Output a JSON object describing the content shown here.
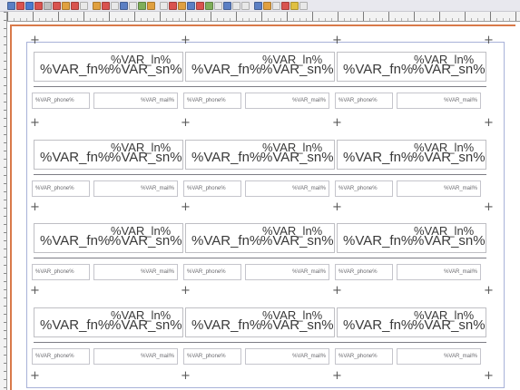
{
  "toolbar": {
    "buttons": [
      {
        "icon": "new-icon",
        "color": "#5b7fc4"
      },
      {
        "icon": "open-icon",
        "color": "#d9534f"
      },
      {
        "icon": "save-icon",
        "color": "#4a7bd0"
      },
      {
        "icon": "print-icon",
        "color": "#d9534f"
      },
      {
        "icon": "cut-icon",
        "color": "#c0c0c0"
      },
      {
        "icon": "copy-icon",
        "color": "#d9534f"
      },
      {
        "icon": "paste-icon",
        "color": "#e0a040"
      },
      {
        "icon": "undo-icon",
        "color": "#d9534f"
      },
      {
        "icon": "redo-icon",
        "color": "#e8e8e8"
      },
      {
        "icon": "zoom-icon",
        "color": "#e0a040"
      },
      {
        "icon": "frame-icon",
        "color": "#d9534f"
      },
      {
        "icon": "grid-icon",
        "color": "#e8e8e8"
      },
      {
        "icon": "table-icon",
        "color": "#5b7fc4"
      },
      {
        "icon": "image-icon",
        "color": "#e8e8e8"
      },
      {
        "icon": "shape-icon",
        "color": "#7fae5a"
      },
      {
        "icon": "line-icon",
        "color": "#e0a040"
      },
      {
        "icon": "text-icon",
        "color": "#e8e8e8"
      },
      {
        "icon": "pen-icon",
        "color": "#d9534f"
      },
      {
        "icon": "pencil-icon",
        "color": "#e0a040"
      },
      {
        "icon": "brush-icon",
        "color": "#5b7fc4"
      },
      {
        "icon": "eyedropper-icon",
        "color": "#d9534f"
      },
      {
        "icon": "measure-icon",
        "color": "#7fae5a"
      },
      {
        "icon": "align-icon",
        "color": "#e8e8e8"
      },
      {
        "icon": "link-icon",
        "color": "#5b7fc4"
      },
      {
        "icon": "unlink-icon",
        "color": "#e8e8e8"
      },
      {
        "icon": "font-icon",
        "color": "#e8e8e8"
      },
      {
        "icon": "script-icon",
        "color": "#5b7fc4"
      },
      {
        "icon": "chart-icon",
        "color": "#e0a040"
      },
      {
        "icon": "barcode-icon",
        "color": "#e8e8e8"
      },
      {
        "icon": "pdf-icon",
        "color": "#d9534f"
      },
      {
        "icon": "color-icon",
        "color": "#e0c040"
      },
      {
        "icon": "lightning-icon",
        "color": "#e8e8e8"
      }
    ]
  },
  "accent": {
    "page_edge": "#d97a4a",
    "margin_line": "#a8b2d8"
  },
  "labels": {
    "first_name": "%VAR_fn%",
    "last_name_top": "%VAR_ln%",
    "last_name_bottom": "%VAR_sn%",
    "phone": "%VAR_phone%",
    "mail": "%VAR_mail%"
  },
  "cards": [
    {
      "row": 1,
      "col": 1,
      "fn": "%VAR_fn%",
      "ln": "%VAR_ln%",
      "sn": "%VAR_sn%",
      "phone": "%VAR_phone%",
      "mail": "%VAR_mail%"
    },
    {
      "row": 1,
      "col": 2,
      "fn": "%VAR_fn%",
      "ln": "%VAR_ln%",
      "sn": "%VAR_sn%",
      "phone": "%VAR_phone%",
      "mail": "%VAR_mail%"
    },
    {
      "row": 1,
      "col": 3,
      "fn": "%VAR_fn%",
      "ln": "%VAR_ln%",
      "sn": "%VAR_sn%",
      "phone": "%VAR_phone%",
      "mail": "%VAR_mail%"
    },
    {
      "row": 2,
      "col": 1,
      "fn": "%VAR_fn%",
      "ln": "%VAR_ln%",
      "sn": "%VAR_sn%",
      "phone": "%VAR_phone%",
      "mail": "%VAR_mail%"
    },
    {
      "row": 2,
      "col": 2,
      "fn": "%VAR_fn%",
      "ln": "%VAR_ln%",
      "sn": "%VAR_sn%",
      "phone": "%VAR_phone%",
      "mail": "%VAR_mail%"
    },
    {
      "row": 2,
      "col": 3,
      "fn": "%VAR_fn%",
      "ln": "%VAR_ln%",
      "sn": "%VAR_sn%",
      "phone": "%VAR_phone%",
      "mail": "%VAR_mail%"
    },
    {
      "row": 3,
      "col": 1,
      "fn": "%VAR_fn%",
      "ln": "%VAR_ln%",
      "sn": "%VAR_sn%",
      "phone": "%VAR_phone%",
      "mail": "%VAR_mail%"
    },
    {
      "row": 3,
      "col": 2,
      "fn": "%VAR_fn%",
      "ln": "%VAR_ln%",
      "sn": "%VAR_sn%",
      "phone": "%VAR_phone%",
      "mail": "%VAR_mail%"
    },
    {
      "row": 3,
      "col": 3,
      "fn": "%VAR_fn%",
      "ln": "%VAR_ln%",
      "sn": "%VAR_sn%",
      "phone": "%VAR_phone%",
      "mail": "%VAR_mail%"
    },
    {
      "row": 4,
      "col": 1,
      "fn": "%VAR_fn%",
      "ln": "%VAR_ln%",
      "sn": "%VAR_sn%",
      "phone": "%VAR_phone%",
      "mail": "%VAR_mail%"
    },
    {
      "row": 4,
      "col": 2,
      "fn": "%VAR_fn%",
      "ln": "%VAR_ln%",
      "sn": "%VAR_sn%",
      "phone": "%VAR_phone%",
      "mail": "%VAR_mail%"
    },
    {
      "row": 4,
      "col": 3,
      "fn": "%VAR_fn%",
      "ln": "%VAR_ln%",
      "sn": "%VAR_sn%",
      "phone": "%VAR_phone%",
      "mail": "%VAR_mail%"
    }
  ],
  "crosshair_symbol": "+"
}
